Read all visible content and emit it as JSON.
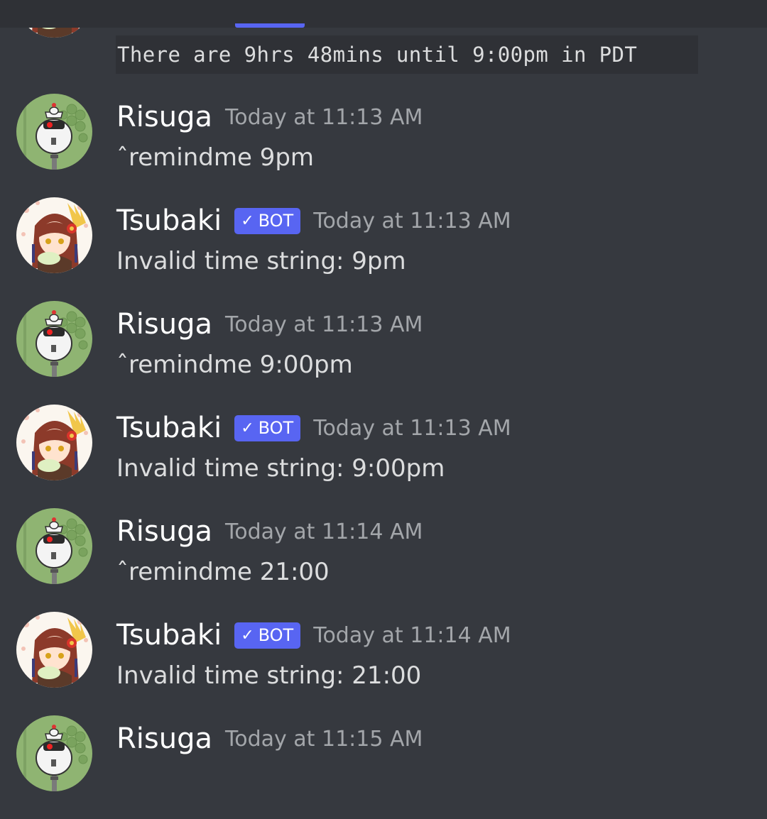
{
  "top_partial": {
    "code_text": "There are 9hrs 48mins until 9:00pm in PDT"
  },
  "messages": [
    {
      "author": "Risuga",
      "bot": false,
      "timestamp": "Today at 11:13 AM",
      "text": "ˆremindme 9pm",
      "avatar": "robot-avatar"
    },
    {
      "author": "Tsubaki",
      "bot": true,
      "badge_check": "✓",
      "badge_label": "BOT",
      "timestamp": "Today at 11:13 AM",
      "text": "Invalid time string: 9pm",
      "avatar": "anime-girl-avatar"
    },
    {
      "author": "Risuga",
      "bot": false,
      "timestamp": "Today at 11:13 AM",
      "text": "ˆremindme 9:00pm",
      "avatar": "robot-avatar"
    },
    {
      "author": "Tsubaki",
      "bot": true,
      "badge_check": "✓",
      "badge_label": "BOT",
      "timestamp": "Today at 11:13 AM",
      "text": "Invalid time string: 9:00pm",
      "avatar": "anime-girl-avatar"
    },
    {
      "author": "Risuga",
      "bot": false,
      "timestamp": "Today at 11:14 AM",
      "text": "ˆremindme 21:00",
      "avatar": "robot-avatar"
    },
    {
      "author": "Tsubaki",
      "bot": true,
      "badge_check": "✓",
      "badge_label": "BOT",
      "timestamp": "Today at 11:14 AM",
      "text": "Invalid time string: 21:00",
      "avatar": "anime-girl-avatar"
    },
    {
      "author": "Risuga",
      "bot": false,
      "timestamp": "Today at 11:15 AM",
      "text": "",
      "avatar": "robot-avatar"
    }
  ],
  "colors": {
    "background": "#36393f",
    "topbar": "#2f3136",
    "bot_badge": "#5865f2",
    "timestamp": "#a3a6aa",
    "message_text": "#dcddde"
  }
}
